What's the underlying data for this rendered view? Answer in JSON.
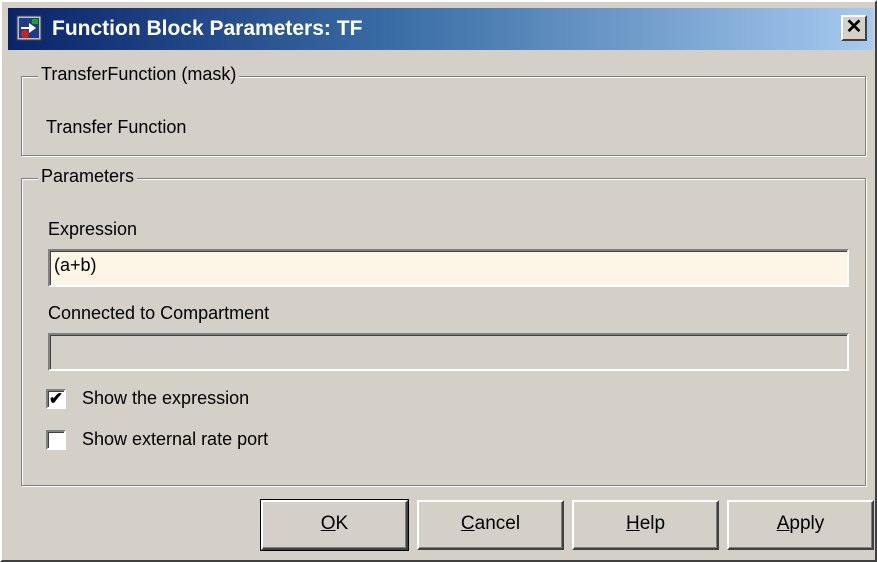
{
  "window": {
    "title": "Function Block Parameters: TF",
    "close_glyph": "✕",
    "icon": "simulink-block-icon"
  },
  "mask_group": {
    "legend": "TransferFunction (mask)",
    "description": "Transfer Function"
  },
  "parameters_group": {
    "legend": "Parameters",
    "expression_label": "Expression",
    "expression_value": "(a+b)",
    "expression_bg": "#fdf5e6",
    "compartment_label": "Connected to Compartment",
    "compartment_value": "",
    "show_expression": {
      "label": "Show the expression",
      "checked": true,
      "mark": "✔"
    },
    "show_rate_port": {
      "label": "Show external rate port",
      "checked": false,
      "mark": ""
    }
  },
  "buttons": {
    "ok": {
      "mnemonic": "O",
      "rest": "K"
    },
    "cancel": {
      "mnemonic": "C",
      "rest": "ancel"
    },
    "help": {
      "mnemonic": "H",
      "rest": "elp"
    },
    "apply": {
      "mnemonic": "A",
      "rest": "pply"
    }
  },
  "colors": {
    "face": "#d4d0c8",
    "title_start": "#0a246a",
    "title_end": "#a6caf0"
  }
}
